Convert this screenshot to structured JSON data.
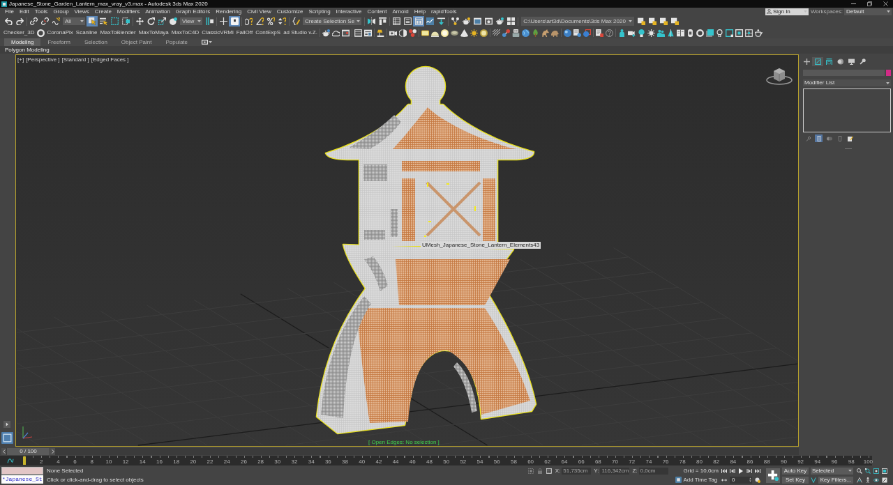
{
  "window": {
    "title": "Japanese_Stone_Garden_Lantern_max_vray_v3.max - Autodesk 3ds Max 2020"
  },
  "menu": [
    "File",
    "Edit",
    "Tools",
    "Group",
    "Views",
    "Create",
    "Modifiers",
    "Animation",
    "Graph Editors",
    "Rendering",
    "Civil View",
    "Customize",
    "Scripting",
    "Interactive",
    "Content",
    "Arnold",
    "Help",
    "rapidTools"
  ],
  "account": {
    "sign_in": "Sign In",
    "workspaces_label": "Workspaces:",
    "workspace": "Default"
  },
  "main_toolbar": [
    {
      "kind": "undo",
      "selected": false
    },
    {
      "kind": "redo",
      "selected": false
    },
    {
      "kind": "separator"
    },
    {
      "kind": "link",
      "selected": false
    },
    {
      "kind": "unlink",
      "selected": false
    },
    {
      "kind": "bind",
      "selected": false
    },
    {
      "kind": "dropdown",
      "value": "All"
    },
    {
      "kind": "select",
      "selected": true
    },
    {
      "kind": "selectname",
      "selected": false
    },
    {
      "kind": "rectregion",
      "selected": false
    },
    {
      "kind": "crossing",
      "selected": false
    },
    {
      "kind": "separator"
    },
    {
      "kind": "move",
      "selected": false
    },
    {
      "kind": "rotate",
      "selected": false
    },
    {
      "kind": "scale",
      "selected": false
    },
    {
      "kind": "place",
      "selected": false
    },
    {
      "kind": "dropdown",
      "value": "View"
    },
    {
      "kind": "pivot",
      "selected": false
    },
    {
      "kind": "separator"
    },
    {
      "kind": "manipulate",
      "selected": false
    },
    {
      "kind": "keyboard",
      "selected": true
    },
    {
      "kind": "separator"
    },
    {
      "kind": "snap",
      "selected": false
    },
    {
      "kind": "anglesnap",
      "selected": false
    },
    {
      "kind": "percentsnap",
      "selected": false
    },
    {
      "kind": "spinnersnap",
      "selected": false
    },
    {
      "kind": "separator"
    },
    {
      "kind": "namedsel",
      "selected": false
    },
    {
      "kind": "dropdown",
      "value": "Create Selection Se"
    },
    {
      "kind": "separator"
    },
    {
      "kind": "mirror",
      "selected": false
    },
    {
      "kind": "align",
      "selected": false
    },
    {
      "kind": "separator"
    },
    {
      "kind": "explorer",
      "selected": false
    },
    {
      "kind": "layer",
      "selected": false
    },
    {
      "kind": "ribbon",
      "selected": true
    },
    {
      "kind": "curve",
      "selected": false
    },
    {
      "kind": "schematic",
      "selected": false
    },
    {
      "kind": "separator"
    },
    {
      "kind": "material",
      "selected": false
    },
    {
      "kind": "matslate",
      "selected": false
    },
    {
      "kind": "rendersetup",
      "selected": false
    },
    {
      "kind": "renderframe",
      "selected": false
    },
    {
      "kind": "render",
      "selected": false
    },
    {
      "kind": "cloud",
      "selected": false
    },
    {
      "kind": "separator"
    },
    {
      "kind": "path",
      "value": "C:\\Users\\art3d\\Documents\\3ds Max 2020"
    },
    {
      "kind": "project",
      "selected": false
    },
    {
      "kind": "project",
      "selected": false
    },
    {
      "kind": "project",
      "selected": false
    },
    {
      "kind": "project",
      "selected": false
    }
  ],
  "scripts_toolbar": [
    {
      "kind": "script",
      "label": "Checker_3D"
    },
    {
      "kind": "ring"
    },
    {
      "kind": "script",
      "label": "CoronaPix"
    },
    {
      "kind": "script",
      "label": "Scanline"
    },
    {
      "kind": "script",
      "label": "MaxToBlender"
    },
    {
      "kind": "script",
      "label": "MaxToMaya"
    },
    {
      "kind": "script",
      "label": "MaxToC4D"
    },
    {
      "kind": "script",
      "label": "ClassicVRMl"
    },
    {
      "kind": "script",
      "label": "FallOff"
    },
    {
      "kind": "script",
      "label": "ContExpS"
    },
    {
      "kind": "script",
      "label": "ad Studio v.Z."
    },
    {
      "kind": "separator"
    },
    {
      "kind": "teapot"
    },
    {
      "kind": "cloudshape"
    },
    {
      "kind": "renderwin"
    },
    {
      "kind": "separator"
    },
    {
      "kind": "listwin"
    },
    {
      "kind": "panel"
    },
    {
      "kind": "separator"
    },
    {
      "kind": "lamp"
    },
    {
      "kind": "separator"
    },
    {
      "kind": "camera"
    },
    {
      "kind": "halfmoon"
    },
    {
      "kind": "cluster"
    },
    {
      "kind": "separator"
    },
    {
      "kind": "arealight"
    },
    {
      "kind": "dome"
    },
    {
      "kind": "glow"
    },
    {
      "kind": "disk"
    },
    {
      "kind": "cone"
    },
    {
      "kind": "sun"
    },
    {
      "kind": "ringlight"
    },
    {
      "kind": "separator"
    },
    {
      "kind": "stripes"
    },
    {
      "kind": "molecule"
    },
    {
      "kind": "robot"
    },
    {
      "kind": "globe"
    },
    {
      "kind": "tree"
    },
    {
      "kind": "horse"
    },
    {
      "kind": "animal"
    },
    {
      "kind": "separator"
    },
    {
      "kind": "sphere"
    },
    {
      "kind": "doc"
    },
    {
      "kind": "sphereframe"
    },
    {
      "kind": "separator"
    },
    {
      "kind": "docred"
    },
    {
      "kind": "help"
    },
    {
      "kind": "separator"
    },
    {
      "kind": "figure"
    },
    {
      "kind": "camplus"
    },
    {
      "kind": "bulb"
    },
    {
      "kind": "sunwhite"
    },
    {
      "kind": "people"
    },
    {
      "kind": "spot"
    },
    {
      "kind": "book"
    },
    {
      "kind": "tag"
    },
    {
      "kind": "donut"
    },
    {
      "kind": "boxteal"
    },
    {
      "kind": "bulboutline"
    },
    {
      "kind": "frame"
    },
    {
      "kind": "framedot"
    },
    {
      "kind": "crossbox"
    },
    {
      "kind": "teapotoutline"
    }
  ],
  "ribbon": {
    "tabs": [
      {
        "label": "Modeling",
        "selected": true
      },
      {
        "label": "Freeform",
        "selected": false
      },
      {
        "label": "Selection",
        "selected": false
      },
      {
        "label": "Object Paint",
        "selected": false
      },
      {
        "label": "Populate",
        "selected": false
      }
    ],
    "panel_title": "Polygon Modeling"
  },
  "viewport": {
    "active": true,
    "labels": [
      "[+]",
      "[Perspective ]",
      "[Standard ]",
      "[Edged Faces ]"
    ],
    "object_tooltip": "UMesh_Japanese_Stone_Lantern_Elements43",
    "status": "[ Open Edges: No selection ]"
  },
  "command_panel": {
    "tabs": [
      {
        "kind": "create",
        "selected": false
      },
      {
        "kind": "modify",
        "selected": true
      },
      {
        "kind": "hierarchy",
        "selected": false
      },
      {
        "kind": "motion",
        "selected": false
      },
      {
        "kind": "display",
        "selected": false
      },
      {
        "kind": "utilities",
        "selected": false
      }
    ],
    "modifier_list": "Modifier List",
    "stack_tools": [
      {
        "kind": "pin",
        "selected": false
      },
      {
        "kind": "endresult",
        "selected": true
      },
      {
        "kind": "unique",
        "selected": false
      },
      {
        "kind": "remove",
        "selected": false
      },
      {
        "kind": "configure",
        "selected": false
      }
    ]
  },
  "time_slider": {
    "label": "0 / 100",
    "level": 0
  },
  "track_bar": {
    "labels": [
      "2",
      "4",
      "6",
      "8",
      "10",
      "12",
      "14",
      "16",
      "18",
      "20",
      "22",
      "24",
      "26",
      "28",
      "30",
      "32",
      "34",
      "36",
      "38",
      "40",
      "42",
      "44",
      "46",
      "48",
      "50",
      "52",
      "54",
      "56",
      "58",
      "60",
      "62",
      "64",
      "66",
      "68",
      "70",
      "72",
      "74",
      "76",
      "78",
      "80",
      "82",
      "84",
      "86",
      "88",
      "90",
      "92",
      "94",
      "96",
      "98",
      "100"
    ]
  },
  "listener": {
    "output": "*Japanese_St"
  },
  "status": {
    "selection": "None Selected",
    "prompt": "Click or click-and-drag to select objects"
  },
  "coordinates": [
    {
      "axis": "X:",
      "value": "51,735cm",
      "disabled": true
    },
    {
      "axis": "Y:",
      "value": "116,342cm",
      "disabled": true
    },
    {
      "axis": "Z:",
      "value": "0,0cm",
      "disabled": true
    }
  ],
  "grid": "Grid = 10,0cm",
  "time_tag": "Add Time Tag",
  "playback": {
    "frame": "0"
  },
  "keying": {
    "auto_key": "Auto Key",
    "set_key": "Set Key",
    "key_set": "Selected",
    "key_filters": "Key Filters..."
  }
}
